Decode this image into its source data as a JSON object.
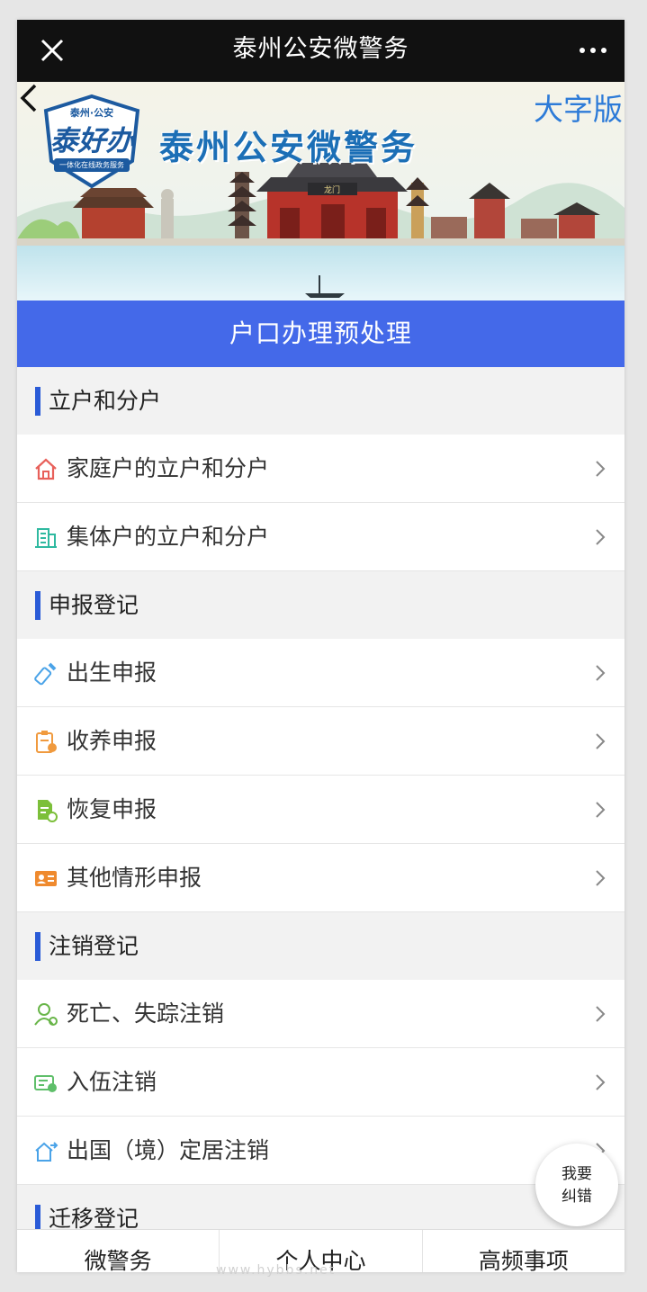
{
  "window": {
    "title": "泰州公安微警务",
    "close_icon": "close-icon",
    "more_icon": "more-dots-icon"
  },
  "banner": {
    "title": "泰州公安微警务",
    "big_font_label": "大字版",
    "badge": {
      "top": "泰州·公安",
      "main": "泰好办",
      "sub": "一体化在线政务服务"
    },
    "gate_plaque": "龙门"
  },
  "page_header": "户口办理预处理",
  "groups": [
    {
      "title": "立户和分户",
      "items": [
        {
          "label": "家庭户的立户和分户",
          "icon": "house-icon",
          "color": "#e8605a"
        },
        {
          "label": "集体户的立户和分户",
          "icon": "building-icon",
          "color": "#2fb9a0"
        }
      ]
    },
    {
      "title": "申报登记",
      "items": [
        {
          "label": "出生申报",
          "icon": "baby-bottle-icon",
          "color": "#4aa3e8"
        },
        {
          "label": "收养申报",
          "icon": "clipboard-icon",
          "color": "#f09a3e"
        },
        {
          "label": "恢复申报",
          "icon": "document-check-icon",
          "color": "#7cbf3a"
        },
        {
          "label": "其他情形申报",
          "icon": "id-card-icon",
          "color": "#ef8a2e"
        }
      ]
    },
    {
      "title": "注销登记",
      "items": [
        {
          "label": "死亡、失踪注销",
          "icon": "person-icon",
          "color": "#68b548"
        },
        {
          "label": "入伍注销",
          "icon": "soldier-card-icon",
          "color": "#5fbf6a"
        },
        {
          "label": "出国（境）定居注销",
          "icon": "house-out-icon",
          "color": "#4aa3e8"
        }
      ]
    },
    {
      "title": "迁移登记",
      "items": []
    }
  ],
  "float_button": {
    "line1": "我要",
    "line2": "纠错"
  },
  "tabbar": {
    "tabs": [
      "微警务",
      "个人中心",
      "高频事项"
    ]
  },
  "watermark": "www.hybbs.net",
  "colors": {
    "accent": "#4469e9",
    "marker": "#2a5bd7",
    "topbar": "#111111"
  }
}
